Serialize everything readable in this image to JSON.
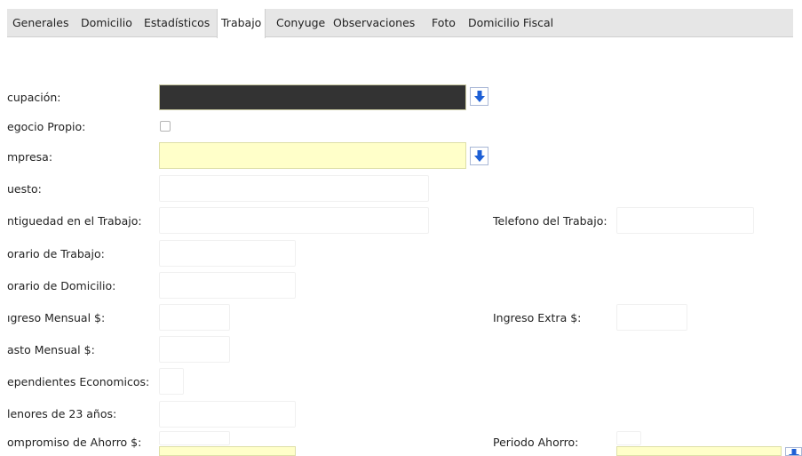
{
  "tabs": [
    "Generales",
    "Domicilio",
    "Estadísticos",
    "Trabajo",
    "Conyuge",
    "Observaciones",
    "Foto",
    "Domicilio Fiscal"
  ],
  "active_tab": "Trabajo",
  "labels": {
    "ocupacion": "cupación:",
    "negocio_propio": "egocio Propio:",
    "empresa": "mpresa:",
    "puesto": "uesto:",
    "antiguedad": "ntiguedad en el Trabajo:",
    "telefono_trabajo": "Telefono del Trabajo:",
    "horario_trabajo": "orario de Trabajo:",
    "horario_domicilio": "orario de Domicilio:",
    "ingreso_mensual": "ıgreso Mensual $:",
    "ingreso_extra": "Ingreso Extra $:",
    "gasto_mensual": "asto Mensual $:",
    "dependientes": "ependientes Economicos:",
    "menores": "lenores de 23 años:",
    "compromiso_ahorro": "ompromiso de Ahorro $:",
    "periodo_ahorro": "Periodo Ahorro:"
  },
  "values": {
    "ocupacion": "",
    "negocio_propio": false,
    "empresa": "",
    "puesto": "",
    "antiguedad": "",
    "telefono_trabajo": "",
    "horario_trabajo": "",
    "horario_domicilio": "",
    "ingreso_mensual": "",
    "ingreso_extra": "",
    "gasto_mensual": "",
    "dependientes": "",
    "menores": "",
    "compromiso_ahorro": "",
    "periodo_ahorro": ""
  },
  "icons": {
    "dropdown": "arrow-down-icon"
  },
  "colors": {
    "tabbar_bg": "#e6e6e6",
    "lookup_field_bg": "#ffffc9",
    "selected_field_bg": "#333333",
    "arrow_blue": "#1d5fd6"
  }
}
